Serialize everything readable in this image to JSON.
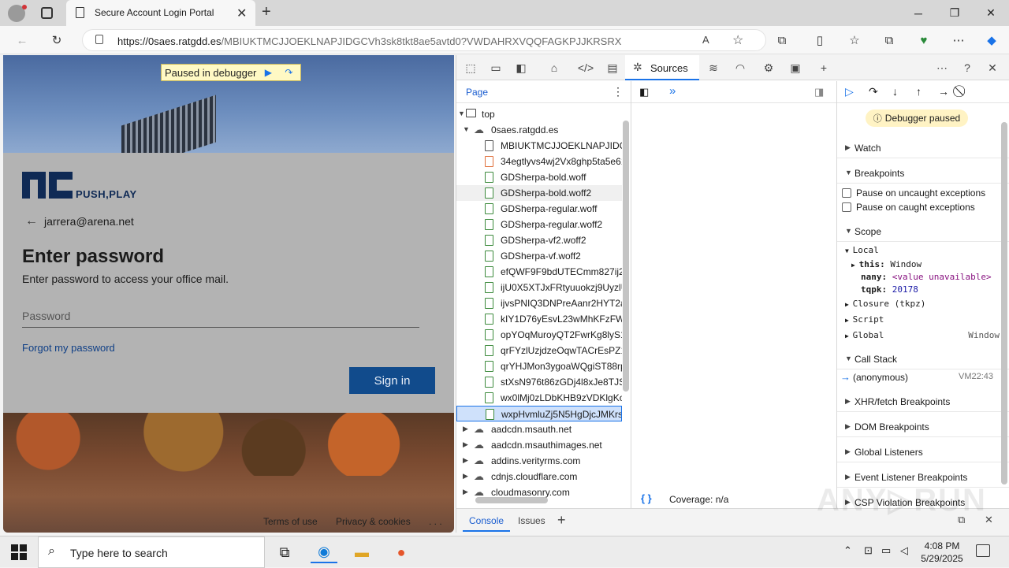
{
  "browser": {
    "tab_title": "Secure Account Login Portal",
    "url_host": "https://0saes.ratgdd.es",
    "url_path": "/MBIUKTMCJJOEKLNAPJIDGCVh3sk8tkt8ae5avtd0?VWDAHRXVQQFAGKPJJKRSRX"
  },
  "page": {
    "paused_label": "Paused in debugger",
    "logo_text": "PUSH,PLAY",
    "email": "jarrera@arena.net",
    "heading": "Enter password",
    "subheading": "Enter password to access your office mail.",
    "password_placeholder": "Password",
    "forgot_link": "Forgot my password",
    "signin_label": "Sign in",
    "footer_terms": "Terms of use",
    "footer_privacy": "Privacy & cookies",
    "footer_more": ". . ."
  },
  "devtools": {
    "active_tab": "Sources",
    "page_tab": "Page",
    "tree": {
      "top": "top",
      "domain": "0saes.ratgdd.es",
      "files": [
        {
          "name": "MBIUKTMCJJOEKLNAPJIDGC",
          "kind": "doc"
        },
        {
          "name": "34egtlyvs4wj2Vx8ghp5ta5e61",
          "kind": "orange"
        },
        {
          "name": "GDSherpa-bold.woff",
          "kind": "font"
        },
        {
          "name": "GDSherpa-bold.woff2",
          "kind": "font"
        },
        {
          "name": "GDSherpa-regular.woff",
          "kind": "font"
        },
        {
          "name": "GDSherpa-regular.woff2",
          "kind": "font"
        },
        {
          "name": "GDSherpa-vf2.woff2",
          "kind": "font"
        },
        {
          "name": "GDSherpa-vf.woff2",
          "kind": "font"
        },
        {
          "name": "efQWF9F9bdUTECmm827ij21",
          "kind": "font"
        },
        {
          "name": "ijU0X5XTJxFRtyuuokzj9UyzlUE",
          "kind": "font"
        },
        {
          "name": "ijvsPNIQ3DNPreAanr2HYT2ar",
          "kind": "font"
        },
        {
          "name": "kIY1D76yEsvL23wMhKFzFWP",
          "kind": "font"
        },
        {
          "name": "opYOqMuroyQT2FwrKg8lyS1",
          "kind": "font"
        },
        {
          "name": "qrFYzlUzjdzeOqwTACrEsPZ15",
          "kind": "font"
        },
        {
          "name": "qrYHJMon3ygoaWQgiST88rp",
          "kind": "font"
        },
        {
          "name": "stXsN976t86zGDj4l8xJe8TJSm",
          "kind": "font"
        },
        {
          "name": "wx0lMj0zLDbKHB9zVDKlgKo",
          "kind": "font"
        },
        {
          "name": "wxpHvmluZj5N5HgDjcJMKrs",
          "kind": "font"
        }
      ],
      "other_domains": [
        "aadcdn.msauth.net",
        "aadcdn.msauthimages.net",
        "addins.verityrms.com",
        "cdnjs.cloudflare.com",
        "cloudmasonry.com"
      ]
    },
    "coverage": "Coverage: n/a",
    "debugger": {
      "status": "Debugger paused",
      "watch": "Watch",
      "breakpoints": "Breakpoints",
      "pause_uncaught": "Pause on uncaught exceptions",
      "pause_caught": "Pause on caught exceptions",
      "scope": "Scope",
      "local": "Local",
      "this_key": "this:",
      "this_val": "Window",
      "nany_key": "nany:",
      "nany_val": "<value unavailable>",
      "tqpk_key": "tqpk:",
      "tqpk_val": "20178",
      "closure": "Closure (tkpz)",
      "script": "Script",
      "global": "Global",
      "global_val": "Window",
      "call_stack": "Call Stack",
      "frame_name": "(anonymous)",
      "frame_loc": "VM22:43",
      "xhr": "XHR/fetch Breakpoints",
      "dom": "DOM Breakpoints",
      "global_listeners": "Global Listeners",
      "event_listener": "Event Listener Breakpoints",
      "csp": "CSP Violation Breakpoints"
    },
    "drawer": {
      "console": "Console",
      "issues": "Issues"
    }
  },
  "taskbar": {
    "search_placeholder": "Type here to search",
    "time": "4:08 PM",
    "date": "5/29/2025"
  },
  "colors": {
    "accent": "#1a73e8",
    "signin": "#114b8c",
    "paused_bg": "#fff9c4"
  }
}
